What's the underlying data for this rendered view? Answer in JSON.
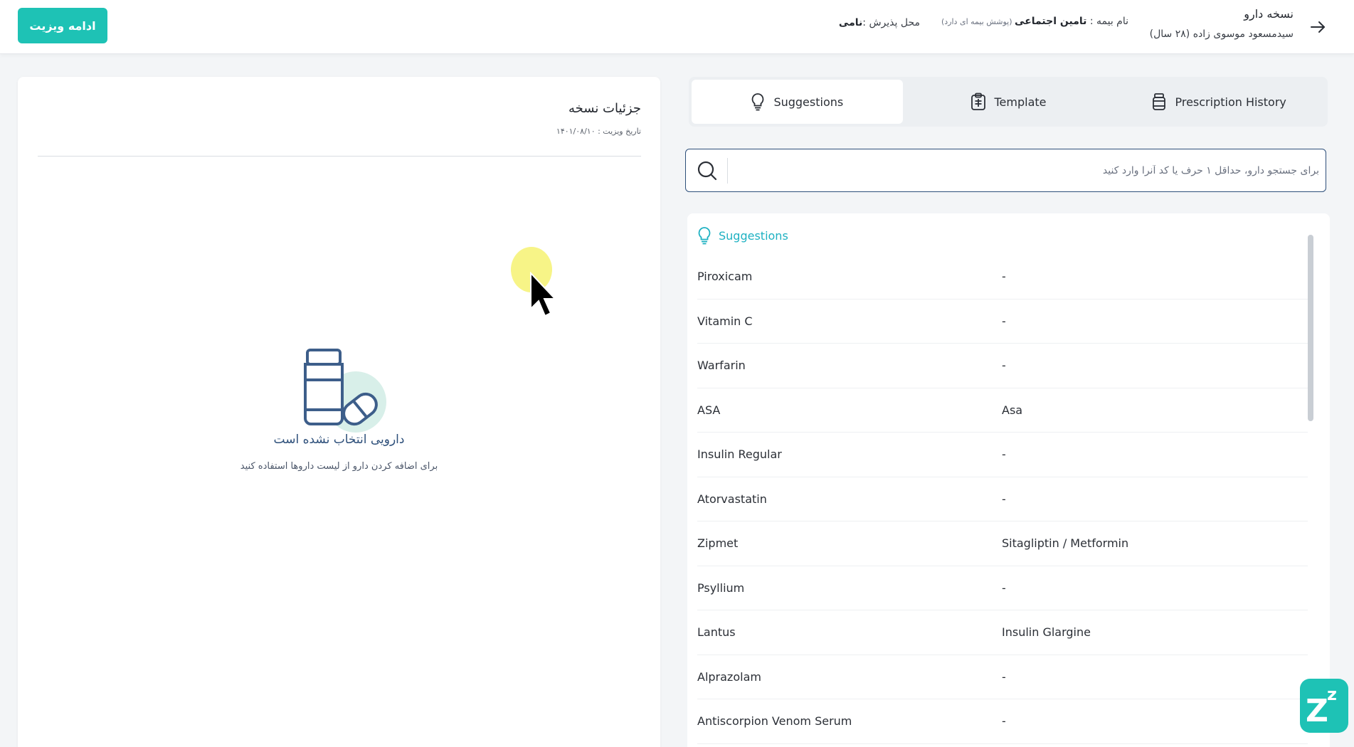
{
  "header": {
    "title": "نسخه دارو",
    "patient": "سیدمسعود موسوی زاده (۲۸ سال)",
    "insurance_label": "نام بیمه : ",
    "insurance_value": "تامین اجتماعی",
    "insurance_note": " (پوشش بیمه ای دارد)",
    "location_label": "محل پذیرش :",
    "location_value": "نامی",
    "continue_button": "ادامه ویزیت"
  },
  "prescription": {
    "title": "جزئیات نسخه",
    "visit_date": "تاریخ ویزیت : ۱۴۰۱/۰۸/۱۰",
    "empty_title": "دارویی انتخاب نشده است",
    "empty_subtitle": "برای اضافه کردن دارو از لیست داروها استفاده کنید"
  },
  "tabs": [
    {
      "label": "Suggestions",
      "icon": "lightbulb-icon",
      "active": true
    },
    {
      "label": "Template",
      "icon": "clipboard-icon",
      "active": false
    },
    {
      "label": "Prescription History",
      "icon": "pill-bottle-icon",
      "active": false
    }
  ],
  "search": {
    "placeholder": "برای جستجو دارو، حداقل ۱ حرف یا کد آنرا وارد کنید",
    "value": ""
  },
  "suggestions": {
    "header": "Suggestions",
    "items": [
      {
        "name": "Piroxicam",
        "generic": "-"
      },
      {
        "name": "Vitamin C",
        "generic": "-"
      },
      {
        "name": "Warfarin",
        "generic": "-"
      },
      {
        "name": "ASA",
        "generic": "Asa"
      },
      {
        "name": "Insulin Regular",
        "generic": "-"
      },
      {
        "name": "Atorvastatin",
        "generic": "-"
      },
      {
        "name": "Zipmet",
        "generic": "Sitagliptin / Metformin"
      },
      {
        "name": "Psyllium",
        "generic": "-"
      },
      {
        "name": "Lantus",
        "generic": "Insulin Glargine"
      },
      {
        "name": "Alprazolam",
        "generic": "-"
      },
      {
        "name": "Antiscorpion Venom Serum",
        "generic": "-"
      }
    ]
  },
  "colors": {
    "accent": "#1ec2b5",
    "primary_dark": "#2d4f7a",
    "suggestion_accent": "#1eb1c2"
  }
}
